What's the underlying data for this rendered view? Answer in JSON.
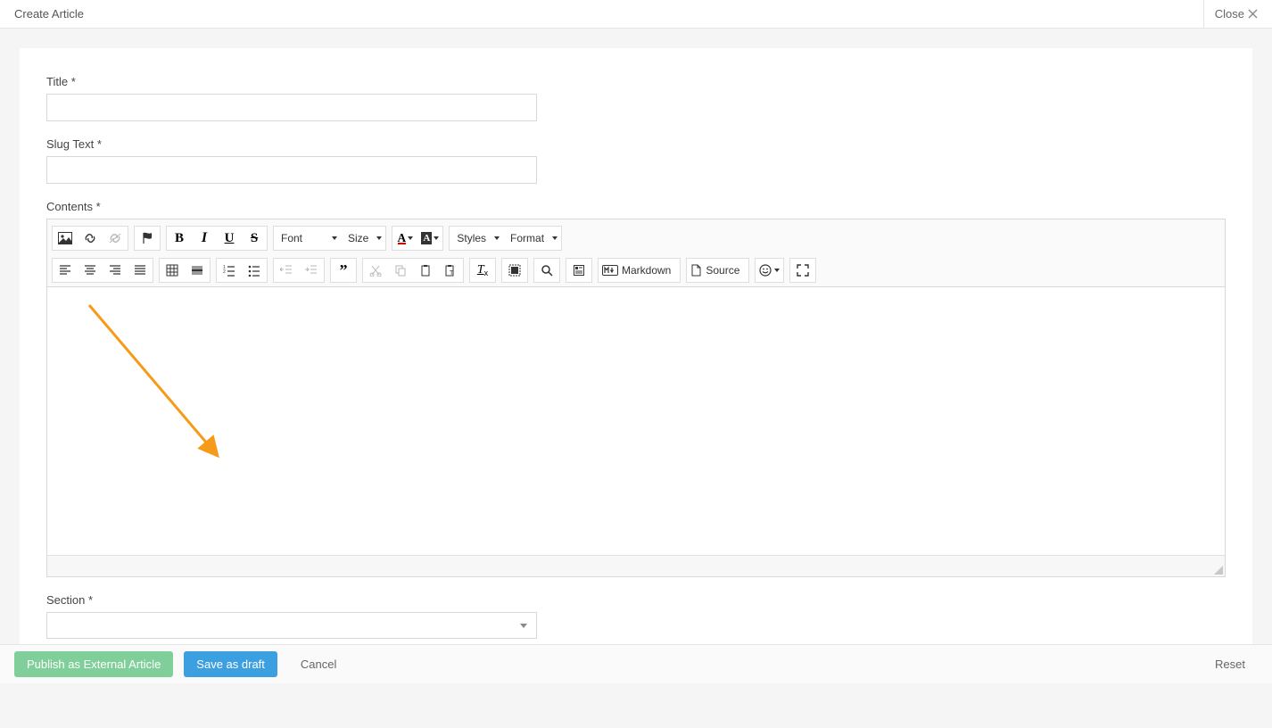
{
  "header": {
    "title": "Create Article",
    "close": "Close"
  },
  "form": {
    "title_label": "Title *",
    "slug_label": "Slug Text *",
    "contents_label": "Contents *",
    "section_label": "Section *",
    "title_value": "",
    "slug_value": ""
  },
  "toolbar": {
    "font": "Font",
    "size": "Size",
    "styles": "Styles",
    "format": "Format",
    "markdown": "Markdown",
    "source": "Source"
  },
  "footer": {
    "publish": "Publish as External Article",
    "draft": "Save as draft",
    "cancel": "Cancel",
    "reset": "Reset"
  }
}
